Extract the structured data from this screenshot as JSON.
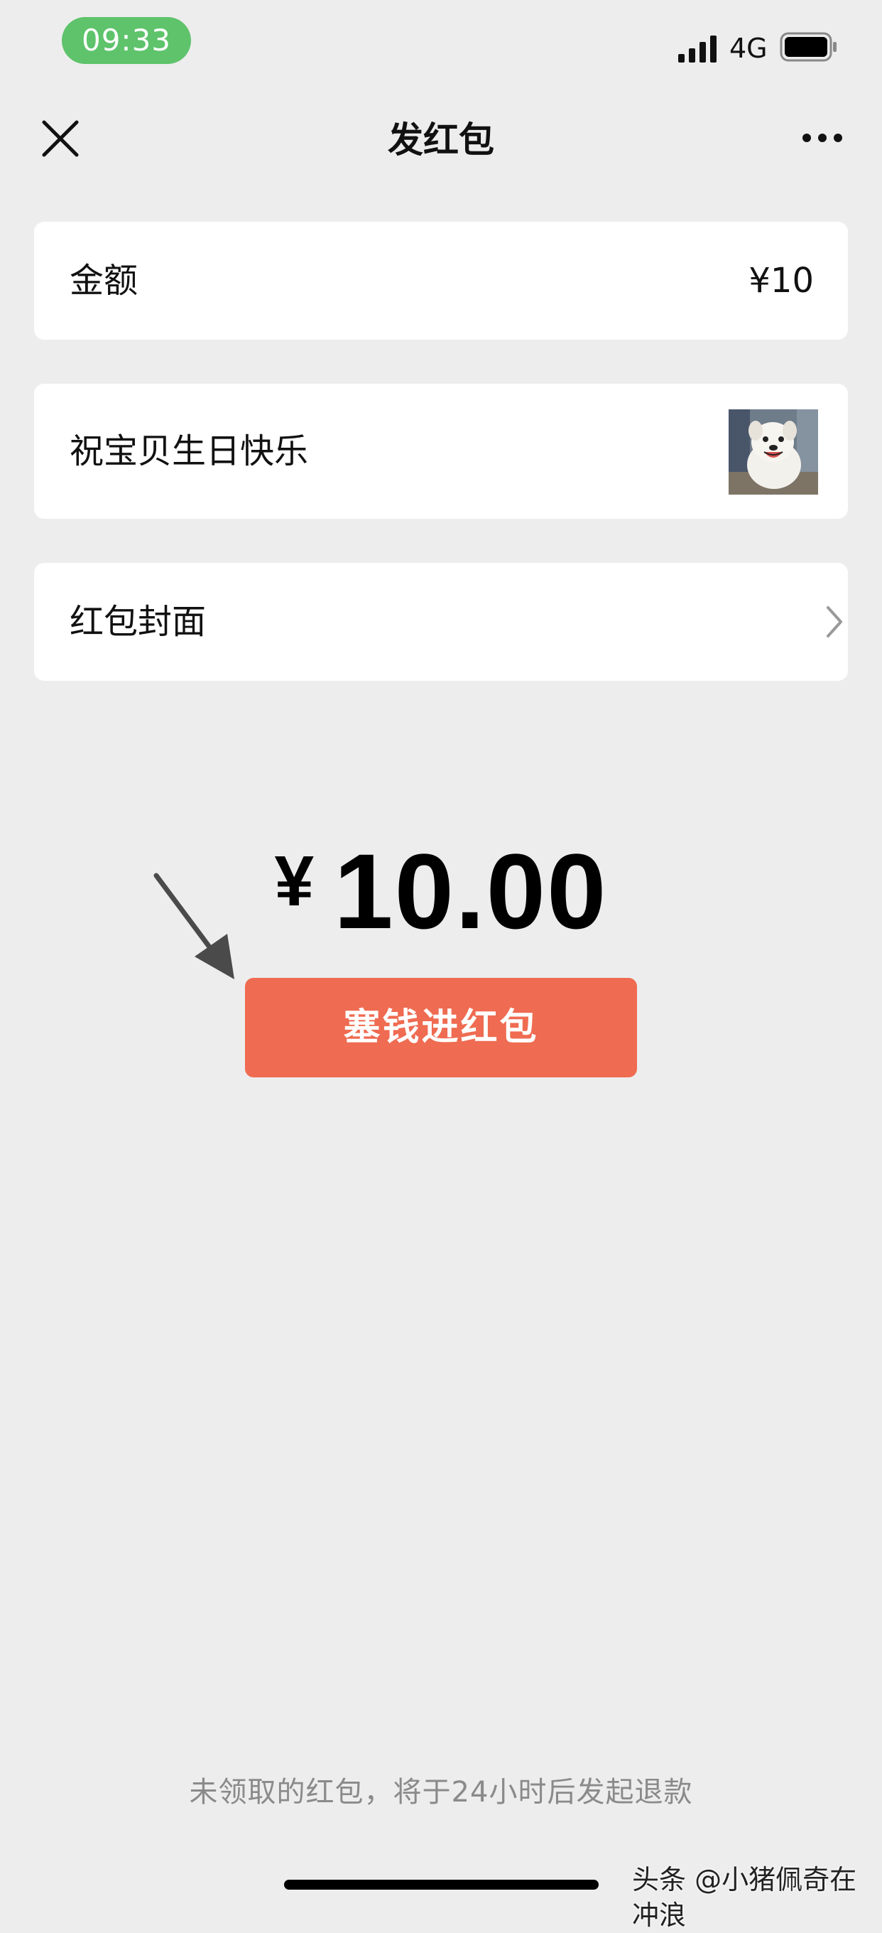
{
  "status_bar": {
    "time": "09:33",
    "network": "4G",
    "pill_color": "#5ec36b",
    "icons": [
      "signal-icon",
      "battery-icon"
    ]
  },
  "nav": {
    "title": "发红包",
    "left_icon": "close-icon",
    "right_icon": "more-icon"
  },
  "amount_card": {
    "label": "金额",
    "value": "¥10"
  },
  "greeting_card": {
    "message": "祝宝贝生日快乐",
    "sticker": "dog-sticker-image"
  },
  "cover_card": {
    "label": "红包封面",
    "icon": "chevron-right-icon"
  },
  "total": {
    "currency": "¥",
    "amount": "10.00"
  },
  "send_button": {
    "label": "塞钱进红包",
    "color": "#ef6b51"
  },
  "footer": {
    "note": "未领取的红包，将于24小时后发起退款"
  },
  "watermark": {
    "text": "头条 @小猪佩奇在冲浪"
  },
  "colors": {
    "background": "#ededed",
    "card": "#ffffff",
    "accent": "#ef6b51"
  }
}
